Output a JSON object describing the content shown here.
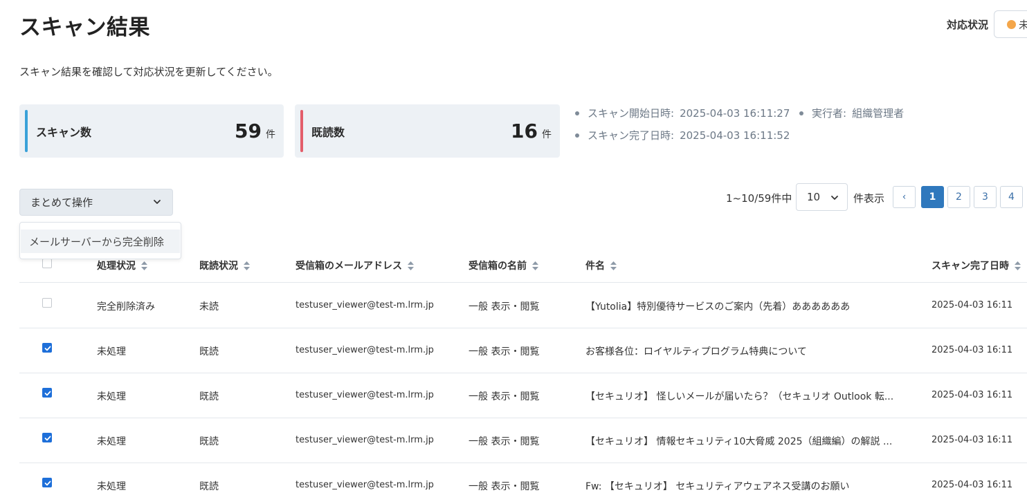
{
  "page": {
    "title": "スキャン結果",
    "subtitle": "スキャン結果を確認して対応状況を更新してください。",
    "status_label": "対応状況",
    "status_value": "未",
    "status_color": "#f4a64a"
  },
  "stats": [
    {
      "label": "スキャン数",
      "value": "59",
      "unit": "件",
      "color": "#3aa1d8"
    },
    {
      "label": "既読数",
      "value": "16",
      "unit": "件",
      "color": "#e35d6a"
    }
  ],
  "meta": {
    "start_label": "スキャン開始日時:",
    "start_value": "2025-04-03 16:11:27",
    "end_label": "スキャン完了日時:",
    "end_value": "2025-04-03 16:11:52",
    "executor_label": "実行者:",
    "executor_value": "組織管理者"
  },
  "bulk": {
    "label": "まとめて操作",
    "menu_items": [
      "メールサーバーから完全削除"
    ]
  },
  "pager": {
    "info": "1~10/59件中",
    "per_page": "10",
    "per_page_label": "件表示",
    "prev": "‹",
    "pages": [
      "1",
      "2",
      "3",
      "4"
    ],
    "current": "1"
  },
  "table": {
    "columns": [
      "処理状況",
      "既読状況",
      "受信箱のメールアドレス",
      "受信箱の名前",
      "件名",
      "スキャン完了日時"
    ],
    "rows": [
      {
        "checked": false,
        "status": "完全削除済み",
        "read": "未読",
        "email": "testuser_viewer@test-m.lrm.jp",
        "name": "一般 表示・閲覧",
        "subject": "【Yutolia】特別優待サービスのご案内（先着）ああああああ",
        "date": "2025-04-03 16:11"
      },
      {
        "checked": true,
        "status": "未処理",
        "read": "既読",
        "email": "testuser_viewer@test-m.lrm.jp",
        "name": "一般 表示・閲覧",
        "subject": "お客様各位：ロイヤルティプログラム特典について",
        "date": "2025-04-03 16:11"
      },
      {
        "checked": true,
        "status": "未処理",
        "read": "既読",
        "email": "testuser_viewer@test-m.lrm.jp",
        "name": "一般 表示・閲覧",
        "subject": "【セキュリオ】 怪しいメールが届いたら？（セキュリオ Outlook 転...",
        "date": "2025-04-03 16:11"
      },
      {
        "checked": true,
        "status": "未処理",
        "read": "既読",
        "email": "testuser_viewer@test-m.lrm.jp",
        "name": "一般 表示・閲覧",
        "subject": "【セキュリオ】 情報セキュリティ10大脅威 2025（組織編）の解説 ...",
        "date": "2025-04-03 16:11"
      },
      {
        "checked": true,
        "status": "未処理",
        "read": "既読",
        "email": "testuser_viewer@test-m.lrm.jp",
        "name": "一般 表示・閲覧",
        "subject": "Fw: 【セキュリオ】 セキュリティアウェアネス受講のお願い",
        "date": "2025-04-03 16:11"
      }
    ]
  },
  "colors": {
    "accent": "#2f78bd",
    "checkbox": "#1e6fd9",
    "card_bg": "#edf1f5"
  }
}
